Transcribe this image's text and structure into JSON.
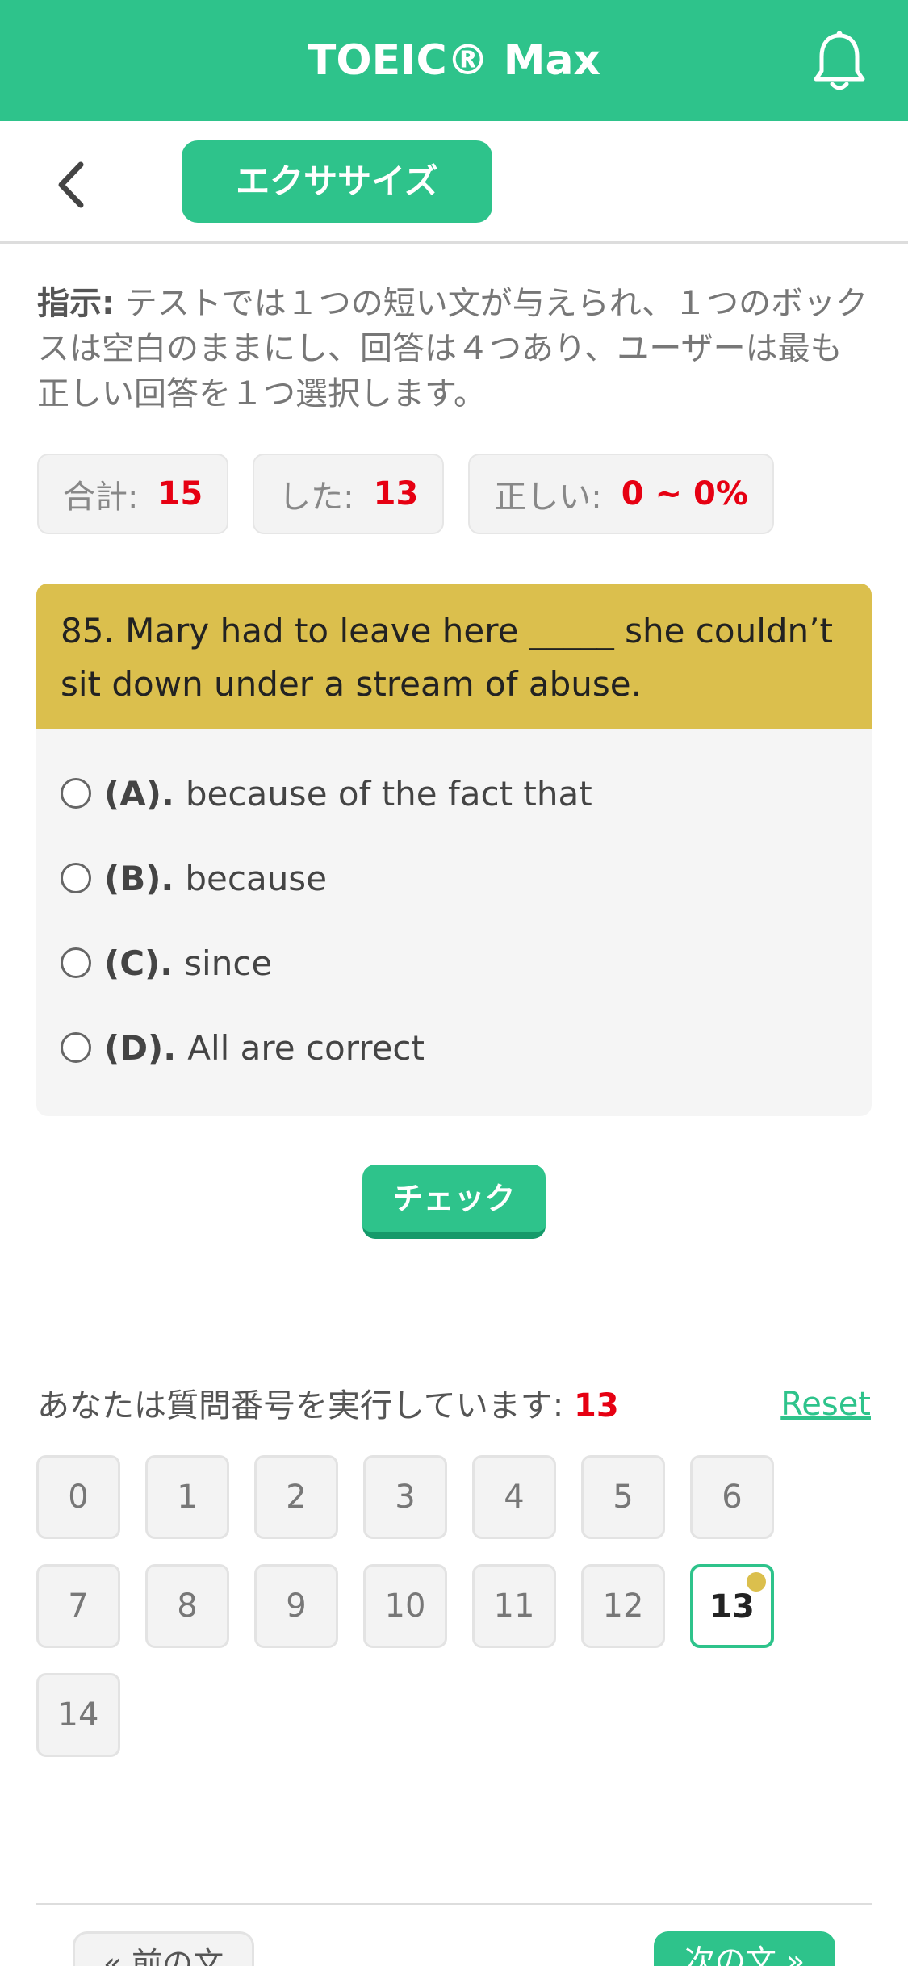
{
  "app": {
    "title": "TOEIC® Max"
  },
  "subbar": {
    "tab_label": "エクササイズ"
  },
  "instructions": {
    "label": "指示:",
    "text": " テストでは１つの短い文が与えられ、１つのボックスは空白のままにし、回答は４つあり、ユーザーは最も正しい回答を１つ選択します。"
  },
  "stats": {
    "total_label": "合計:",
    "total_value": "15",
    "done_label": "した:",
    "done_value": "13",
    "correct_label": "正しい:",
    "correct_value": "0 ~ 0%"
  },
  "question": {
    "text": "85. Mary had to leave here _____ she couldn’t sit down under a stream of abuse.",
    "options": [
      {
        "label": "(A).",
        "text": "because of the fact that"
      },
      {
        "label": "(B).",
        "text": "because"
      },
      {
        "label": "(C).",
        "text": "since"
      },
      {
        "label": "(D).",
        "text": "All are correct"
      }
    ]
  },
  "check_label": "チェック",
  "progress": {
    "label": "あなたは質問番号を実行しています:",
    "current": "13",
    "reset_label": "Reset"
  },
  "question_numbers": [
    "0",
    "1",
    "2",
    "3",
    "4",
    "5",
    "6",
    "7",
    "8",
    "9",
    "10",
    "11",
    "12",
    "13",
    "14"
  ],
  "navigation": {
    "prev_label": "« 前の文",
    "next_label": "次の文 »"
  },
  "colors": {
    "brand_green": "#2ec38b",
    "question_header": "#dbbf4d",
    "highlight_red": "#e60012"
  },
  "icons": {
    "bell": "bell-icon",
    "back": "chevron-left-icon"
  }
}
